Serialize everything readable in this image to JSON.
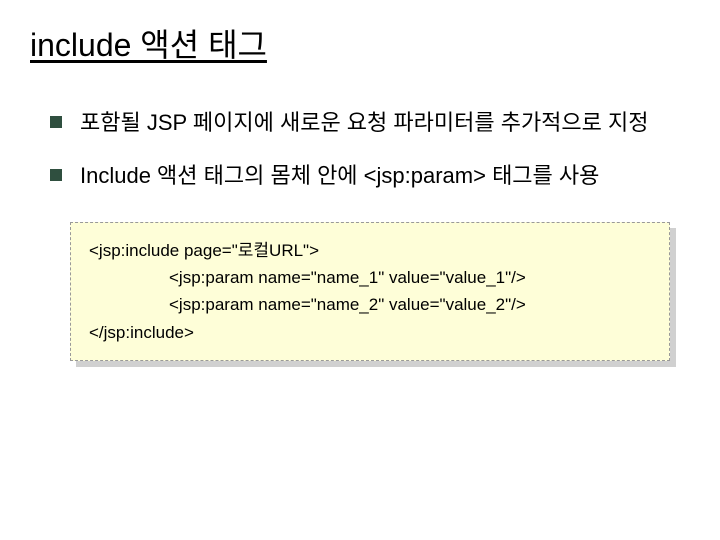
{
  "title": "include 액션 태그",
  "bullets": [
    "포함될 JSP 페이지에 새로운 요청 파라미터를 추가적으로 지정",
    "Include 액션 태그의 몸체 안에 <jsp:param> 태그를 사용"
  ],
  "code": {
    "line1": "<jsp:include page=\"로컬URL\">",
    "line2": "<jsp:param name=\"name_1\" value=\"value_1\"/>",
    "line3": "<jsp:param name=\"name_2\" value=\"value_2\"/>",
    "line4": "</jsp:include>"
  }
}
